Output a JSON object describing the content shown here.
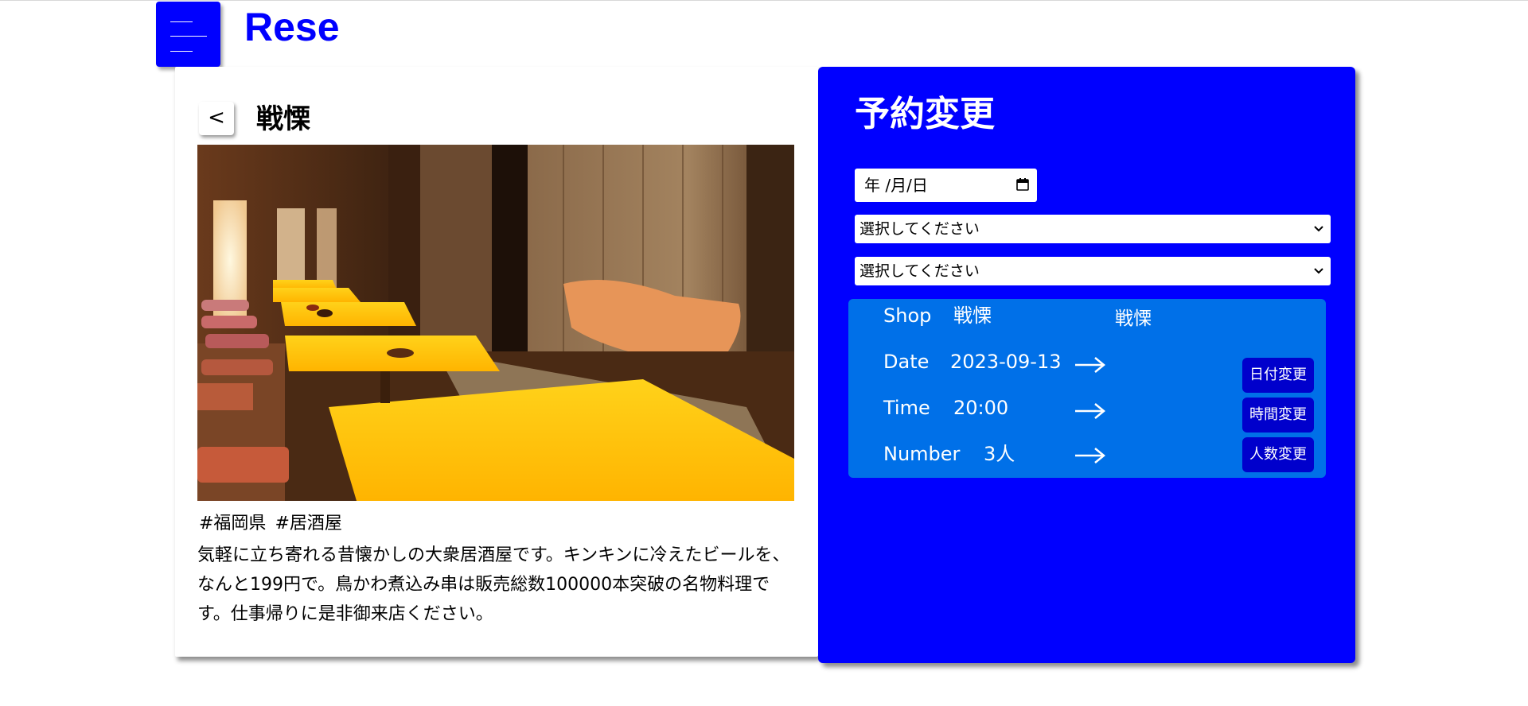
{
  "header": {
    "brand": "Rese"
  },
  "shop": {
    "back_label": "<",
    "name": "戦慄",
    "tags": [
      "#福岡県",
      "#居酒屋"
    ],
    "description": "気軽に立ち寄れる昔懐かしの大衆居酒屋です。キンキンに冷えたビールを、なんと199円で。鳥かわ煮込み串は販売総数100000本突破の名物料理です。仕事帰りに是非御来店ください。"
  },
  "reservation": {
    "title": "予約変更",
    "date_placeholder": "年 /月/日",
    "time_select": "選択してください",
    "number_select": "選択してください",
    "summary": {
      "shop_label": "Shop",
      "shop_value": "戦慄",
      "shop_new": "戦慄",
      "date_label": "Date",
      "date_value": "2023-09-13",
      "time_label": "Time",
      "time_value": "20:00",
      "number_label": "Number",
      "number_value": "3人"
    },
    "buttons": {
      "change_date": "日付変更",
      "change_time": "時間変更",
      "change_number": "人数変更"
    }
  },
  "colors": {
    "brand": "#0000ff",
    "summary_bg": "#0070e8",
    "button_bg": "#0000cc"
  }
}
